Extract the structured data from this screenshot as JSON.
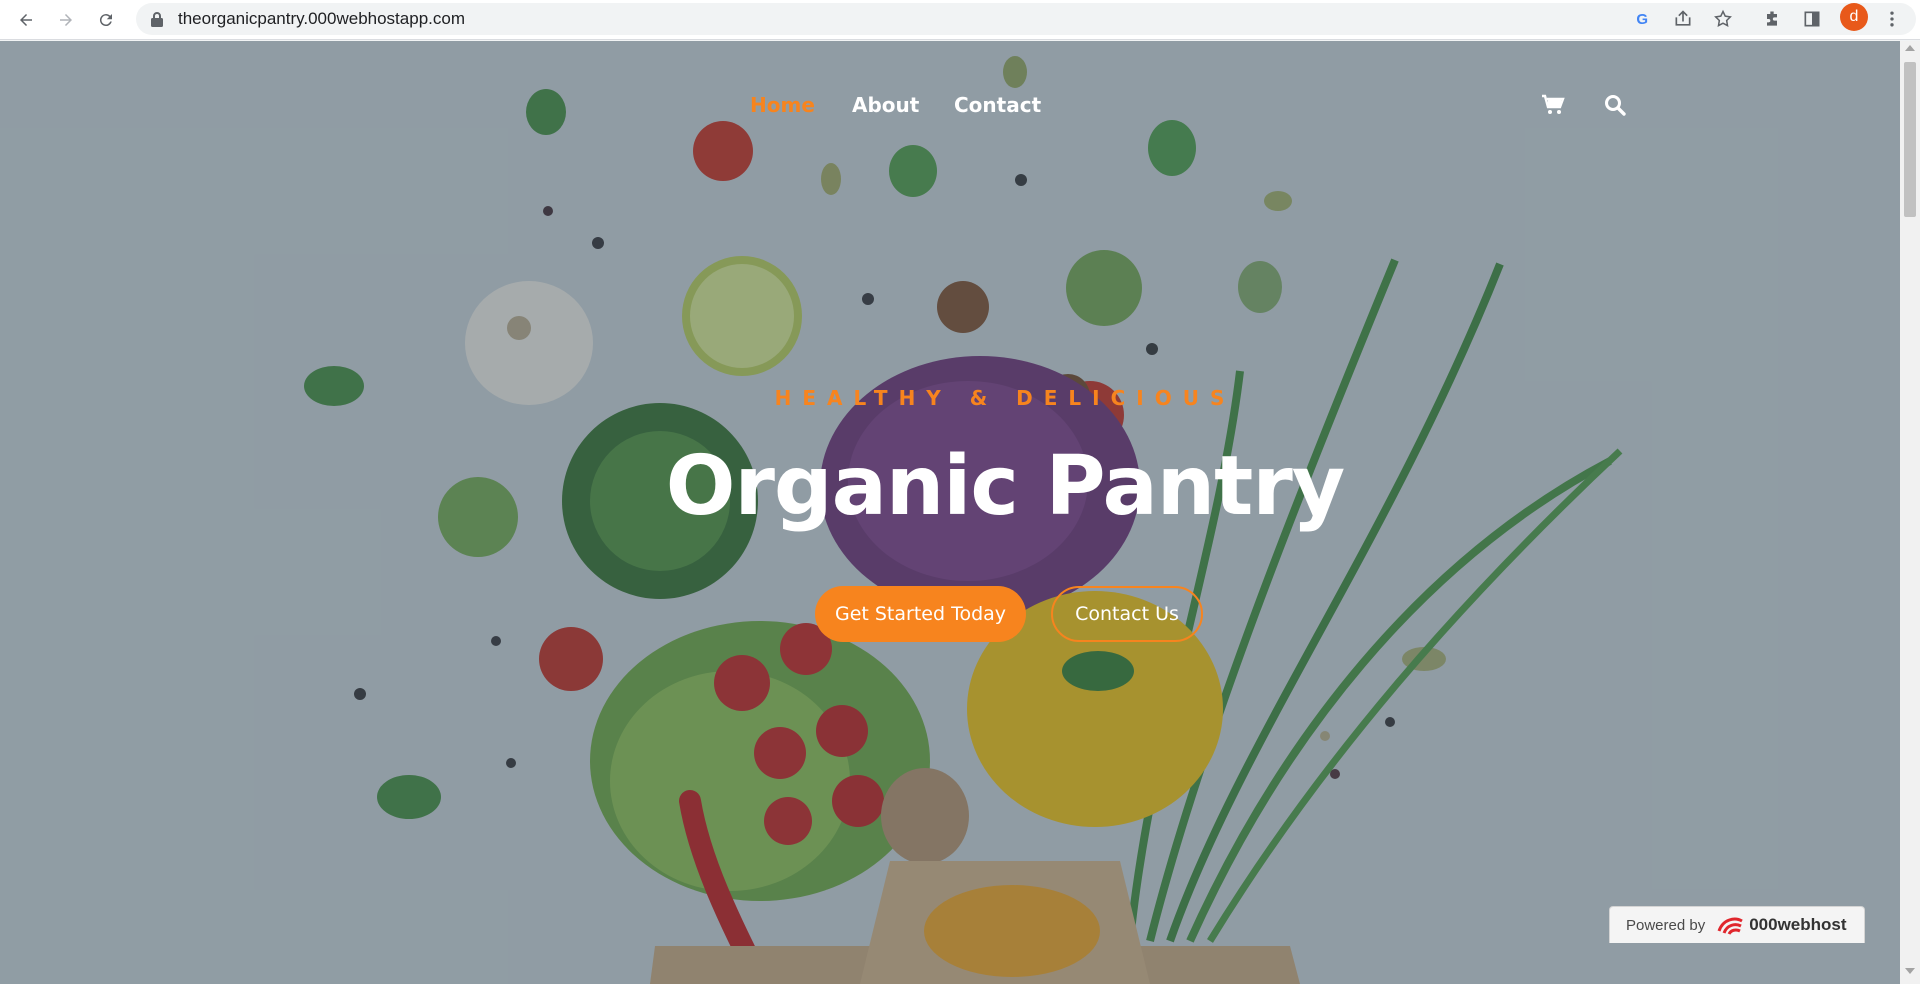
{
  "browser": {
    "url": "theorganicpantry.000webhostapp.com",
    "profile_initial": "d"
  },
  "site": {
    "nav": {
      "items": [
        {
          "label": "Home",
          "active": true
        },
        {
          "label": "About",
          "active": false
        },
        {
          "label": "Contact",
          "active": false
        }
      ],
      "icons": [
        "cart-icon",
        "search-icon"
      ]
    },
    "hero": {
      "kicker": "HEALTHY & DELICIOUS",
      "title": "Organic Pantry",
      "primary_button": "Get Started Today",
      "secondary_button": "Contact Us"
    },
    "badge": {
      "prefix": "Powered by",
      "brand": "000webhost"
    }
  },
  "colors": {
    "accent": "#f7841e",
    "text": "#ffffff",
    "browser_avatar": "#e8591a"
  }
}
